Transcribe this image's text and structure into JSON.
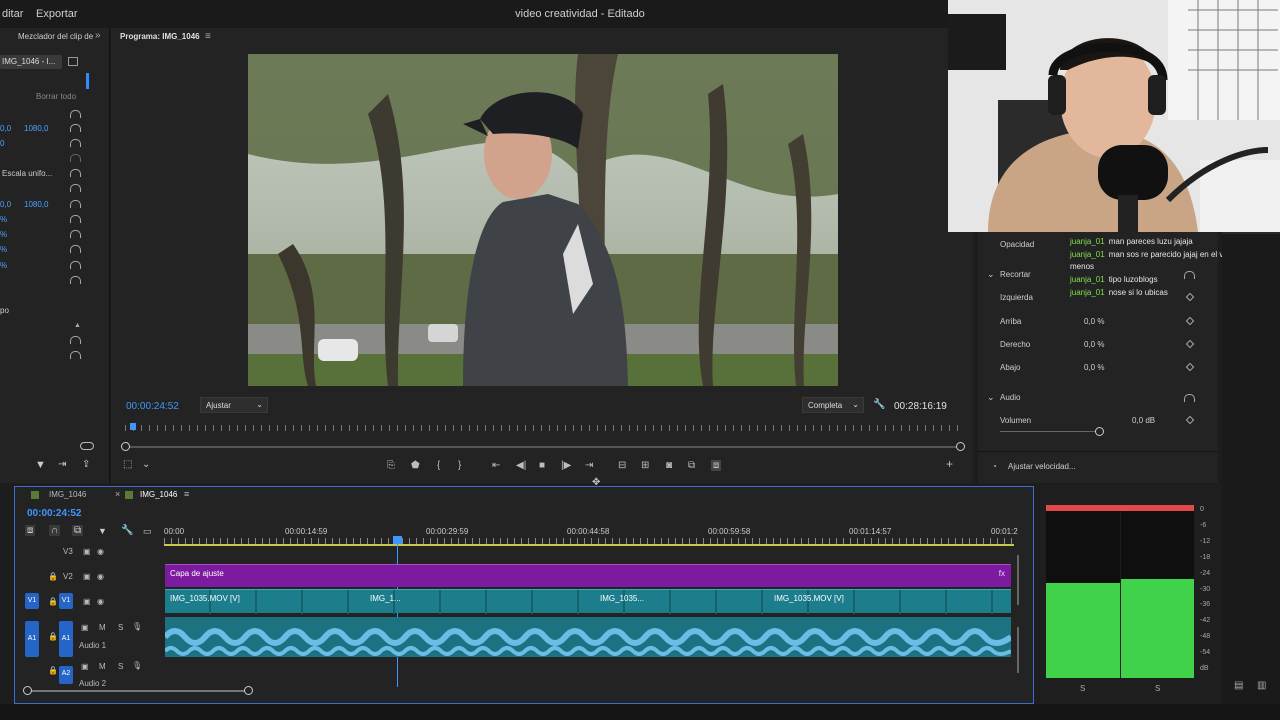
{
  "topbar": {
    "menu_edit": "ditar",
    "menu_export": "Exportar",
    "title": "video creatividad - Editado"
  },
  "leftpanel": {
    "tab_mixer": "Mezclador del clip de",
    "clip_select": "IMG_1046 - I...",
    "clear_all": "Borrar todo",
    "pos_x": "0,0",
    "pos_y": "1080,0",
    "val_zero": "0",
    "uniform_scale": "Escala unifo...",
    "anchor_x": "0,0",
    "anchor_y": "1080,0",
    "pct_1": "%",
    "pct_2": "%",
    "pct_3": "%",
    "pct_4": "%",
    "time_label": "po"
  },
  "monitor": {
    "title": "Programa: IMG_1046",
    "timecode_current": "00:00:24:52",
    "fit_select": "Ajustar",
    "quality_select": "Completa",
    "timecode_total": "00:28:16:19"
  },
  "effects": {
    "opacity": "Opacidad",
    "crop": "Recortar",
    "left": "Izquierda",
    "top": "Arriba",
    "top_val": "0,0 %",
    "right": "Derecho",
    "right_val": "0,0 %",
    "bottom": "Abajo",
    "bottom_val": "0,0 %",
    "audio": "Audio",
    "volume": "Volumen",
    "volume_val": "0,0 dB",
    "speed_btn": "Ajustar velocidad..."
  },
  "chat": {
    "messages": [
      {
        "user": "juanja_01",
        "text": "man pareces luzu jajaja"
      },
      {
        "user": "juanja_01",
        "text": "man sos re parecido jajaj en el video al menos"
      },
      {
        "user": "juanja_01",
        "text": "tipo luzoblogs"
      },
      {
        "user": "juanja_01",
        "text": "nose si lo ubicas"
      }
    ]
  },
  "timeline": {
    "tab1": "IMG_1046",
    "tab2": "IMG_1046",
    "timecode": "00:00:24:52",
    "ruler": [
      "00:00",
      "00:00:14:59",
      "00:00:29:59",
      "00:00:44:58",
      "00:00:59:58",
      "00:01:14:57",
      "00:01:2"
    ],
    "tracks": {
      "v3": "V3",
      "v2": "V2",
      "v1": "V1",
      "a1": "A1",
      "a2": "A2",
      "v1_src": "V1",
      "a1_src": "A1",
      "audio1": "Audio 1",
      "audio2": "Audio 2"
    },
    "adjustment_clip": "Capa de ajuste",
    "clips": [
      "IMG_1035.MOV [V]",
      "IMG_1...",
      "IMG_1035...",
      "IMG_1035.MOV [V]"
    ]
  },
  "meter": {
    "scale": [
      "0",
      "-6",
      "-12",
      "-18",
      "-24",
      "-30",
      "-36",
      "-42",
      "-48",
      "-54",
      "dB"
    ],
    "solo_l": "S",
    "solo_r": "S",
    "level_l": 0.57,
    "level_r": 0.59
  },
  "colors": {
    "accent": "#2d8cff",
    "adjustment": "#7d1ba0",
    "video_clip": "#1c7d8c",
    "audio_wave": "#7fd0ff",
    "meter_green": "#3fd24a",
    "meter_red": "#e24a4a"
  }
}
